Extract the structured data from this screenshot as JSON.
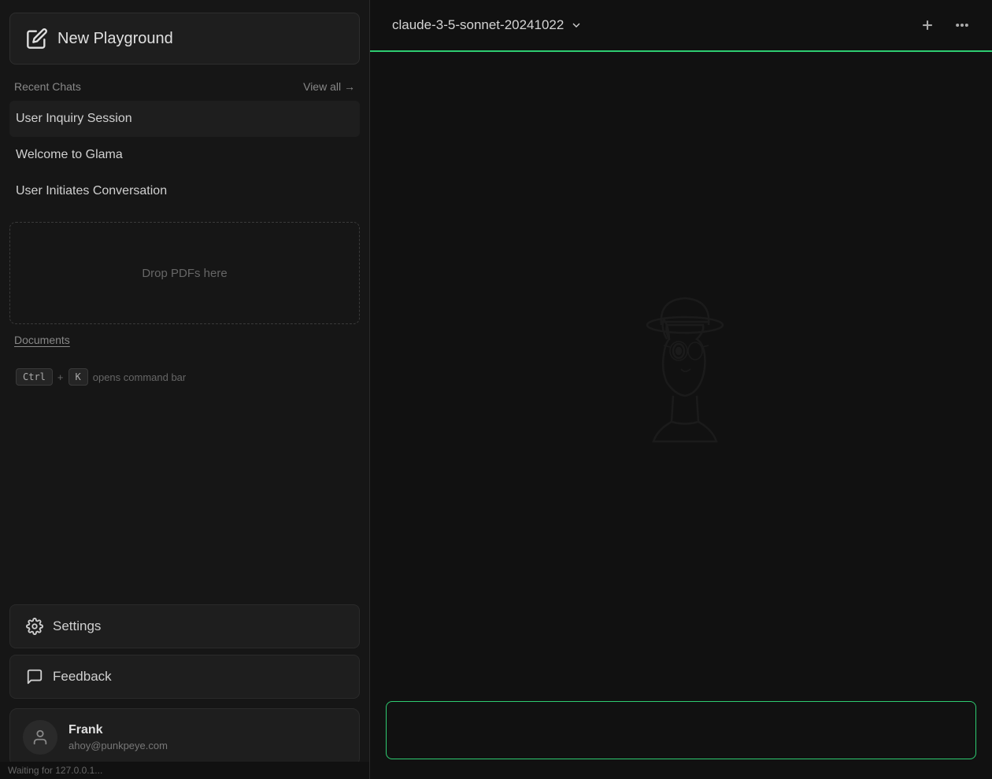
{
  "sidebar": {
    "new_playground_label": "New Playground",
    "recent_chats_label": "Recent Chats",
    "view_all_label": "View all →",
    "chats": [
      {
        "id": "chat-1",
        "title": "User Inquiry Session"
      },
      {
        "id": "chat-2",
        "title": "Welcome to Glama"
      },
      {
        "id": "chat-3",
        "title": "User Initiates Conversation"
      }
    ],
    "drop_zone_label": "Drop PDFs here",
    "documents_label": "Documents",
    "keyboard_shortcut_ctrl": "Ctrl",
    "keyboard_shortcut_plus": "+",
    "keyboard_shortcut_k": "K",
    "keyboard_shortcut_desc": "opens command bar",
    "settings_label": "Settings",
    "feedback_label": "Feedback",
    "user": {
      "name": "Frank",
      "email": "ahoy@punkpeye.com"
    },
    "status_bar": "Waiting for 127.0.0.1..."
  },
  "main": {
    "model_name": "claude-3-5-sonnet-20241022",
    "input_placeholder": "",
    "accent_color": "#2ecc71"
  },
  "icons": {
    "edit": "✏",
    "chevron_down": "⌄",
    "plus": "+",
    "ellipsis": "···",
    "gear": "⚙",
    "chat_bubble": "💬",
    "user": "👤"
  }
}
